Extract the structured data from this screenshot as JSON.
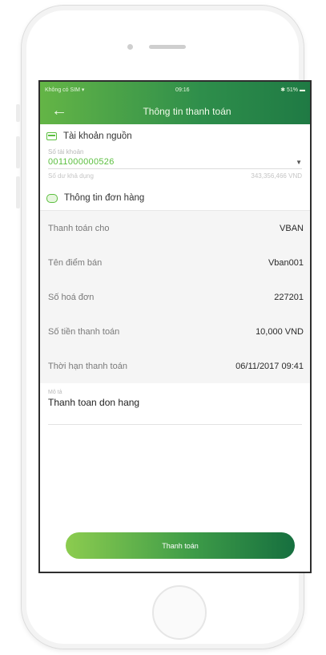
{
  "status_bar": {
    "carrier": "Không có SIM",
    "time": "09:16",
    "battery": "51%"
  },
  "header": {
    "title": "Thông tin thanh toán"
  },
  "source_account": {
    "section_title": "Tài khoản nguồn",
    "account_label": "Số tài khoản",
    "account_number": "0011000000526",
    "balance_label": "Số dư khả dụng",
    "balance_value": "343,356,466 VND"
  },
  "order_info": {
    "section_title": "Thông tin đơn hàng",
    "rows": [
      {
        "label": "Thanh toán cho",
        "value": "VBAN"
      },
      {
        "label": "Tên điểm bán",
        "value": "Vban001"
      },
      {
        "label": "Số hoá đơn",
        "value": "227201"
      },
      {
        "label": "Số tiền thanh toán",
        "value": "10,000 VND"
      },
      {
        "label": "Thời hạn thanh toán",
        "value": "06/11/2017 09:41"
      }
    ]
  },
  "description": {
    "label": "Mô tả",
    "value": "Thanh toan don hang"
  },
  "actions": {
    "pay_label": "Thanh toán"
  },
  "colors": {
    "brand_green": "#2e8e4b",
    "accent_green": "#5bbf3f"
  }
}
